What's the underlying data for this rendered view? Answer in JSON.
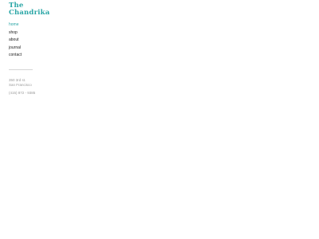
{
  "brand": {
    "line1": "The",
    "line2": "Chandrika",
    "color": "#2aa6a6"
  },
  "nav": {
    "items": [
      {
        "label": "home",
        "active": true
      },
      {
        "label": "shop",
        "active": false
      },
      {
        "label": "about",
        "active": false
      },
      {
        "label": "journal",
        "active": false
      },
      {
        "label": "contact",
        "active": false
      }
    ]
  },
  "contact": {
    "address_line1": "350 3rd st.",
    "address_line2": "San Francisco",
    "phone": "(415) 872 - 9385"
  }
}
